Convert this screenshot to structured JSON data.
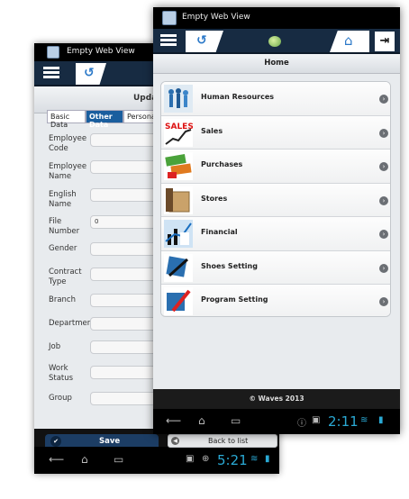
{
  "back_window": {
    "app_title": "Empty Web View",
    "page_title": "Update",
    "tabs": [
      {
        "label": "Basic Data"
      },
      {
        "label": "Other Data"
      },
      {
        "label": "Personal"
      }
    ],
    "fields": [
      {
        "label": "Employee Code",
        "value": ""
      },
      {
        "label": "Employee Name",
        "value": ""
      },
      {
        "label": "English Name",
        "value": ""
      },
      {
        "label": "File Number",
        "value": "0"
      },
      {
        "label": "Gender",
        "value": ""
      },
      {
        "label": "Contract Type",
        "value": ""
      },
      {
        "label": "Branch",
        "value": ""
      },
      {
        "label": "Department",
        "value": ""
      },
      {
        "label": "Job",
        "value": ""
      },
      {
        "label": "Work Status",
        "value": ""
      },
      {
        "label": "Group",
        "value": ""
      }
    ],
    "save_label": "Save",
    "back_to_list_label": "Back to list",
    "clock": "5:21"
  },
  "front_window": {
    "app_title": "Empty Web View",
    "page_title": "Home",
    "menu_items": [
      {
        "label": "Human Resources",
        "icon": "hr-people-icon"
      },
      {
        "label": "Sales",
        "icon": "sales-chart-icon"
      },
      {
        "label": "Purchases",
        "icon": "cash-credit-icon"
      },
      {
        "label": "Stores",
        "icon": "stores-box-icon"
      },
      {
        "label": "Financial",
        "icon": "financial-chart-icon"
      },
      {
        "label": "Shoes Setting",
        "icon": "shoes-setting-icon"
      },
      {
        "label": "Program Setting",
        "icon": "program-setting-icon"
      }
    ],
    "footer": "© Waves 2013",
    "clock": "2:11"
  }
}
